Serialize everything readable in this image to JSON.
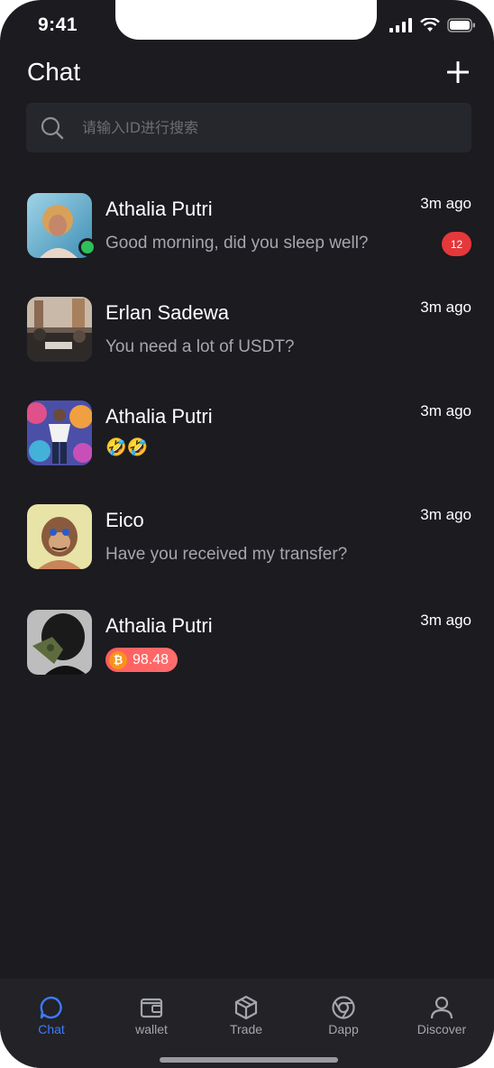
{
  "status": {
    "time": "9:41"
  },
  "header": {
    "title": "Chat"
  },
  "search": {
    "placeholder": "请输入ID进行搜索"
  },
  "chats": [
    {
      "name": "Athalia Putri",
      "message": "Good morning, did you sleep well?",
      "time": "3m ago",
      "badge": "12",
      "online": true
    },
    {
      "name": "Erlan Sadewa",
      "message": "You need a lot of USDT?",
      "time": "3m ago"
    },
    {
      "name": "Athalia Putri",
      "message": "🤣🤣",
      "time": "3m ago"
    },
    {
      "name": "Eico",
      "message": "Have you received my transfer?",
      "time": "3m ago"
    },
    {
      "name": "Athalia Putri",
      "amount": "98.48",
      "coin_symbol": "₿",
      "time": "3m ago"
    }
  ],
  "tabs": [
    {
      "label": "Chat",
      "icon": "chat-bubble-icon",
      "active": true
    },
    {
      "label": "wallet",
      "icon": "wallet-icon"
    },
    {
      "label": "Trade",
      "icon": "cube-icon"
    },
    {
      "label": "Dapp",
      "icon": "browser-icon"
    },
    {
      "label": "Discover",
      "icon": "user-icon"
    }
  ],
  "colors": {
    "background": "#1b1b20",
    "accent": "#3d7bff",
    "badge": "#e5383b",
    "online": "#2ec05a"
  }
}
